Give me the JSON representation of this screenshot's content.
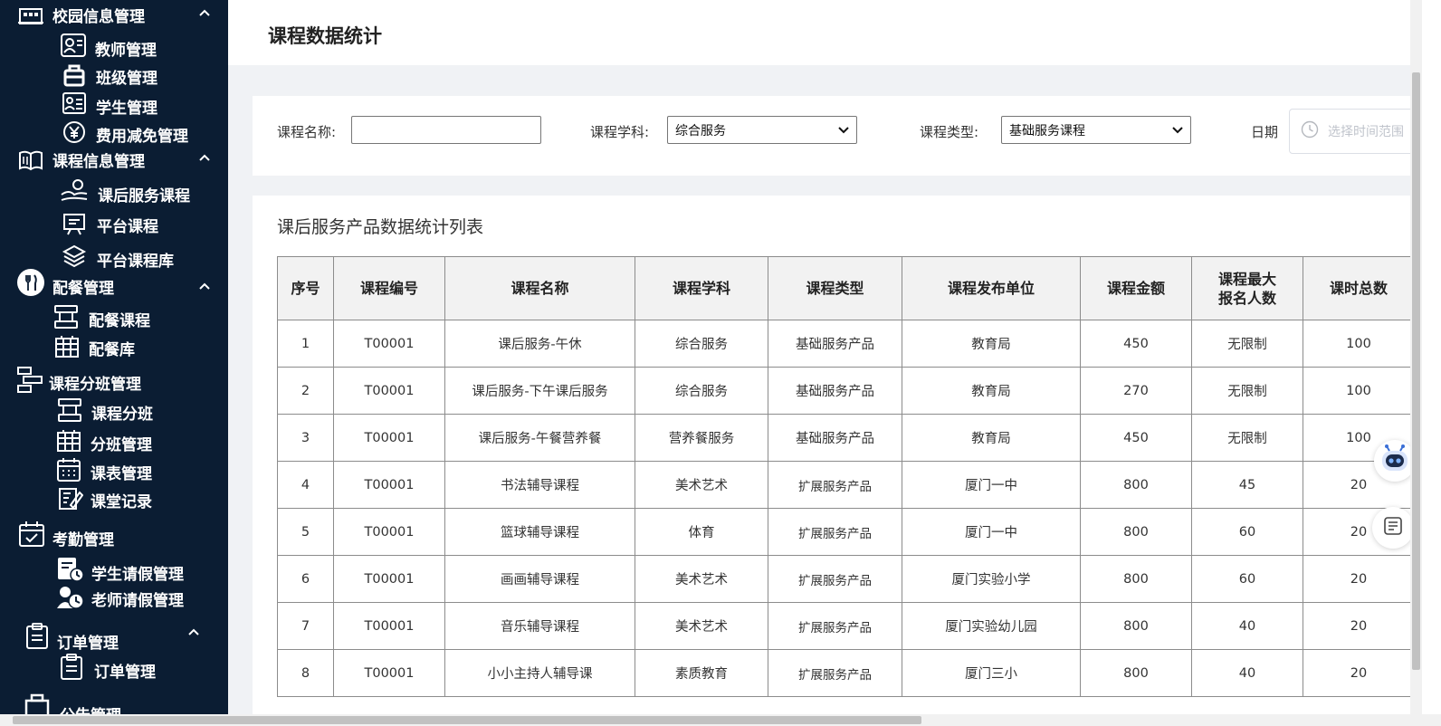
{
  "sidebar": {
    "items": [
      {
        "label": "校园信息管理",
        "icon": "building-icon",
        "level": 1,
        "expanded": true
      },
      {
        "label": "教师管理",
        "icon": "teacher-icon",
        "level": 2
      },
      {
        "label": "班级管理",
        "icon": "class-icon",
        "level": 2
      },
      {
        "label": "学生管理",
        "icon": "student-card-icon",
        "level": 2
      },
      {
        "label": "费用减免管理",
        "icon": "yen-circle-icon",
        "level": 2
      },
      {
        "label": "课程信息管理",
        "icon": "book-icon",
        "level": 1,
        "expanded": true
      },
      {
        "label": "课后服务课程",
        "icon": "service-hand-icon",
        "level": 2
      },
      {
        "label": "平台课程",
        "icon": "board-icon",
        "level": 2
      },
      {
        "label": "平台课程库",
        "icon": "layers-icon",
        "level": 2
      },
      {
        "label": "配餐管理",
        "icon": "utensils-icon",
        "level": 1,
        "expanded": true
      },
      {
        "label": "配餐课程",
        "icon": "tray-icon",
        "level": 2
      },
      {
        "label": "配餐库",
        "icon": "grid-calendar-icon",
        "level": 2
      },
      {
        "label": "课程分班管理",
        "icon": "split-icon",
        "level": 1
      },
      {
        "label": "课程分班",
        "icon": "tray-icon",
        "level": 2
      },
      {
        "label": "分班管理",
        "icon": "grid-calendar-icon",
        "level": 2
      },
      {
        "label": "课表管理",
        "icon": "schedule-icon",
        "level": 2
      },
      {
        "label": "课堂记录",
        "icon": "record-icon",
        "level": 2
      },
      {
        "label": "考勤管理",
        "icon": "calendar-check-icon",
        "level": 1
      },
      {
        "label": "学生请假管理",
        "icon": "leave-icon",
        "level": 2
      },
      {
        "label": "老师请假管理",
        "icon": "people-leave-icon",
        "level": 2
      },
      {
        "label": "订单管理",
        "icon": "clipboard-icon",
        "level": 1,
        "expanded": true
      },
      {
        "label": "订单管理",
        "icon": "clipboard-icon",
        "level": 2
      },
      {
        "label": "公告管理",
        "icon": "notice-icon",
        "level": 1
      }
    ]
  },
  "page": {
    "title": "课程数据统计"
  },
  "filters": {
    "course_name_label": "课程名称:",
    "course_name_value": "",
    "subject_label": "课程学科:",
    "subject_value": "综合服务",
    "type_label": "课程类型:",
    "type_value": "基础服务课程",
    "date_label": "日期",
    "date_placeholder": "选择时间范围"
  },
  "table": {
    "title": "课后服务产品数据统计列表",
    "headers": [
      "序号",
      "课程编号",
      "课程名称",
      "课程学科",
      "课程类型",
      "课程发布单位",
      "课程金额",
      "课程最大\n报名人数",
      "课时总数"
    ],
    "rows": [
      [
        "1",
        "T00001",
        "课后服务-午休",
        "综合服务",
        "基础服务产品",
        "教育局",
        "450",
        "无限制",
        "100"
      ],
      [
        "2",
        "T00001",
        "课后服务-下午课后服务",
        "综合服务",
        "基础服务产品",
        "教育局",
        "270",
        "无限制",
        "100"
      ],
      [
        "3",
        "T00001",
        "课后服务-午餐营养餐",
        "营养餐服务",
        "基础服务产品",
        "教育局",
        "450",
        "无限制",
        "100"
      ],
      [
        "4",
        "T00001",
        "书法辅导课程",
        "美术艺术",
        "扩展服务产品",
        "厦门一中",
        "800",
        "45",
        "20"
      ],
      [
        "5",
        "T00001",
        "篮球辅导课程",
        "体育",
        "扩展服务产品",
        "厦门一中",
        "800",
        "60",
        "20"
      ],
      [
        "6",
        "T00001",
        "画画辅导课程",
        "美术艺术",
        "扩展服务产品",
        "厦门实验小学",
        "800",
        "60",
        "20"
      ],
      [
        "7",
        "T00001",
        "音乐辅导课程",
        "美术艺术",
        "扩展服务产品",
        "厦门实验幼儿园",
        "800",
        "40",
        "20"
      ],
      [
        "8",
        "T00001",
        "小小主持人辅导课",
        "素质教育",
        "扩展服务产品",
        "厦门三小",
        "800",
        "40",
        "20"
      ]
    ]
  },
  "floating": {
    "assistant_icon": "robot-icon",
    "notes_icon": "notes-icon"
  },
  "colors": {
    "sidebar_bg": "#0b1d33",
    "content_bg": "#f0f2f5",
    "table_header_bg": "#f2f2f2",
    "robot_accent": "#3b6fd6"
  }
}
